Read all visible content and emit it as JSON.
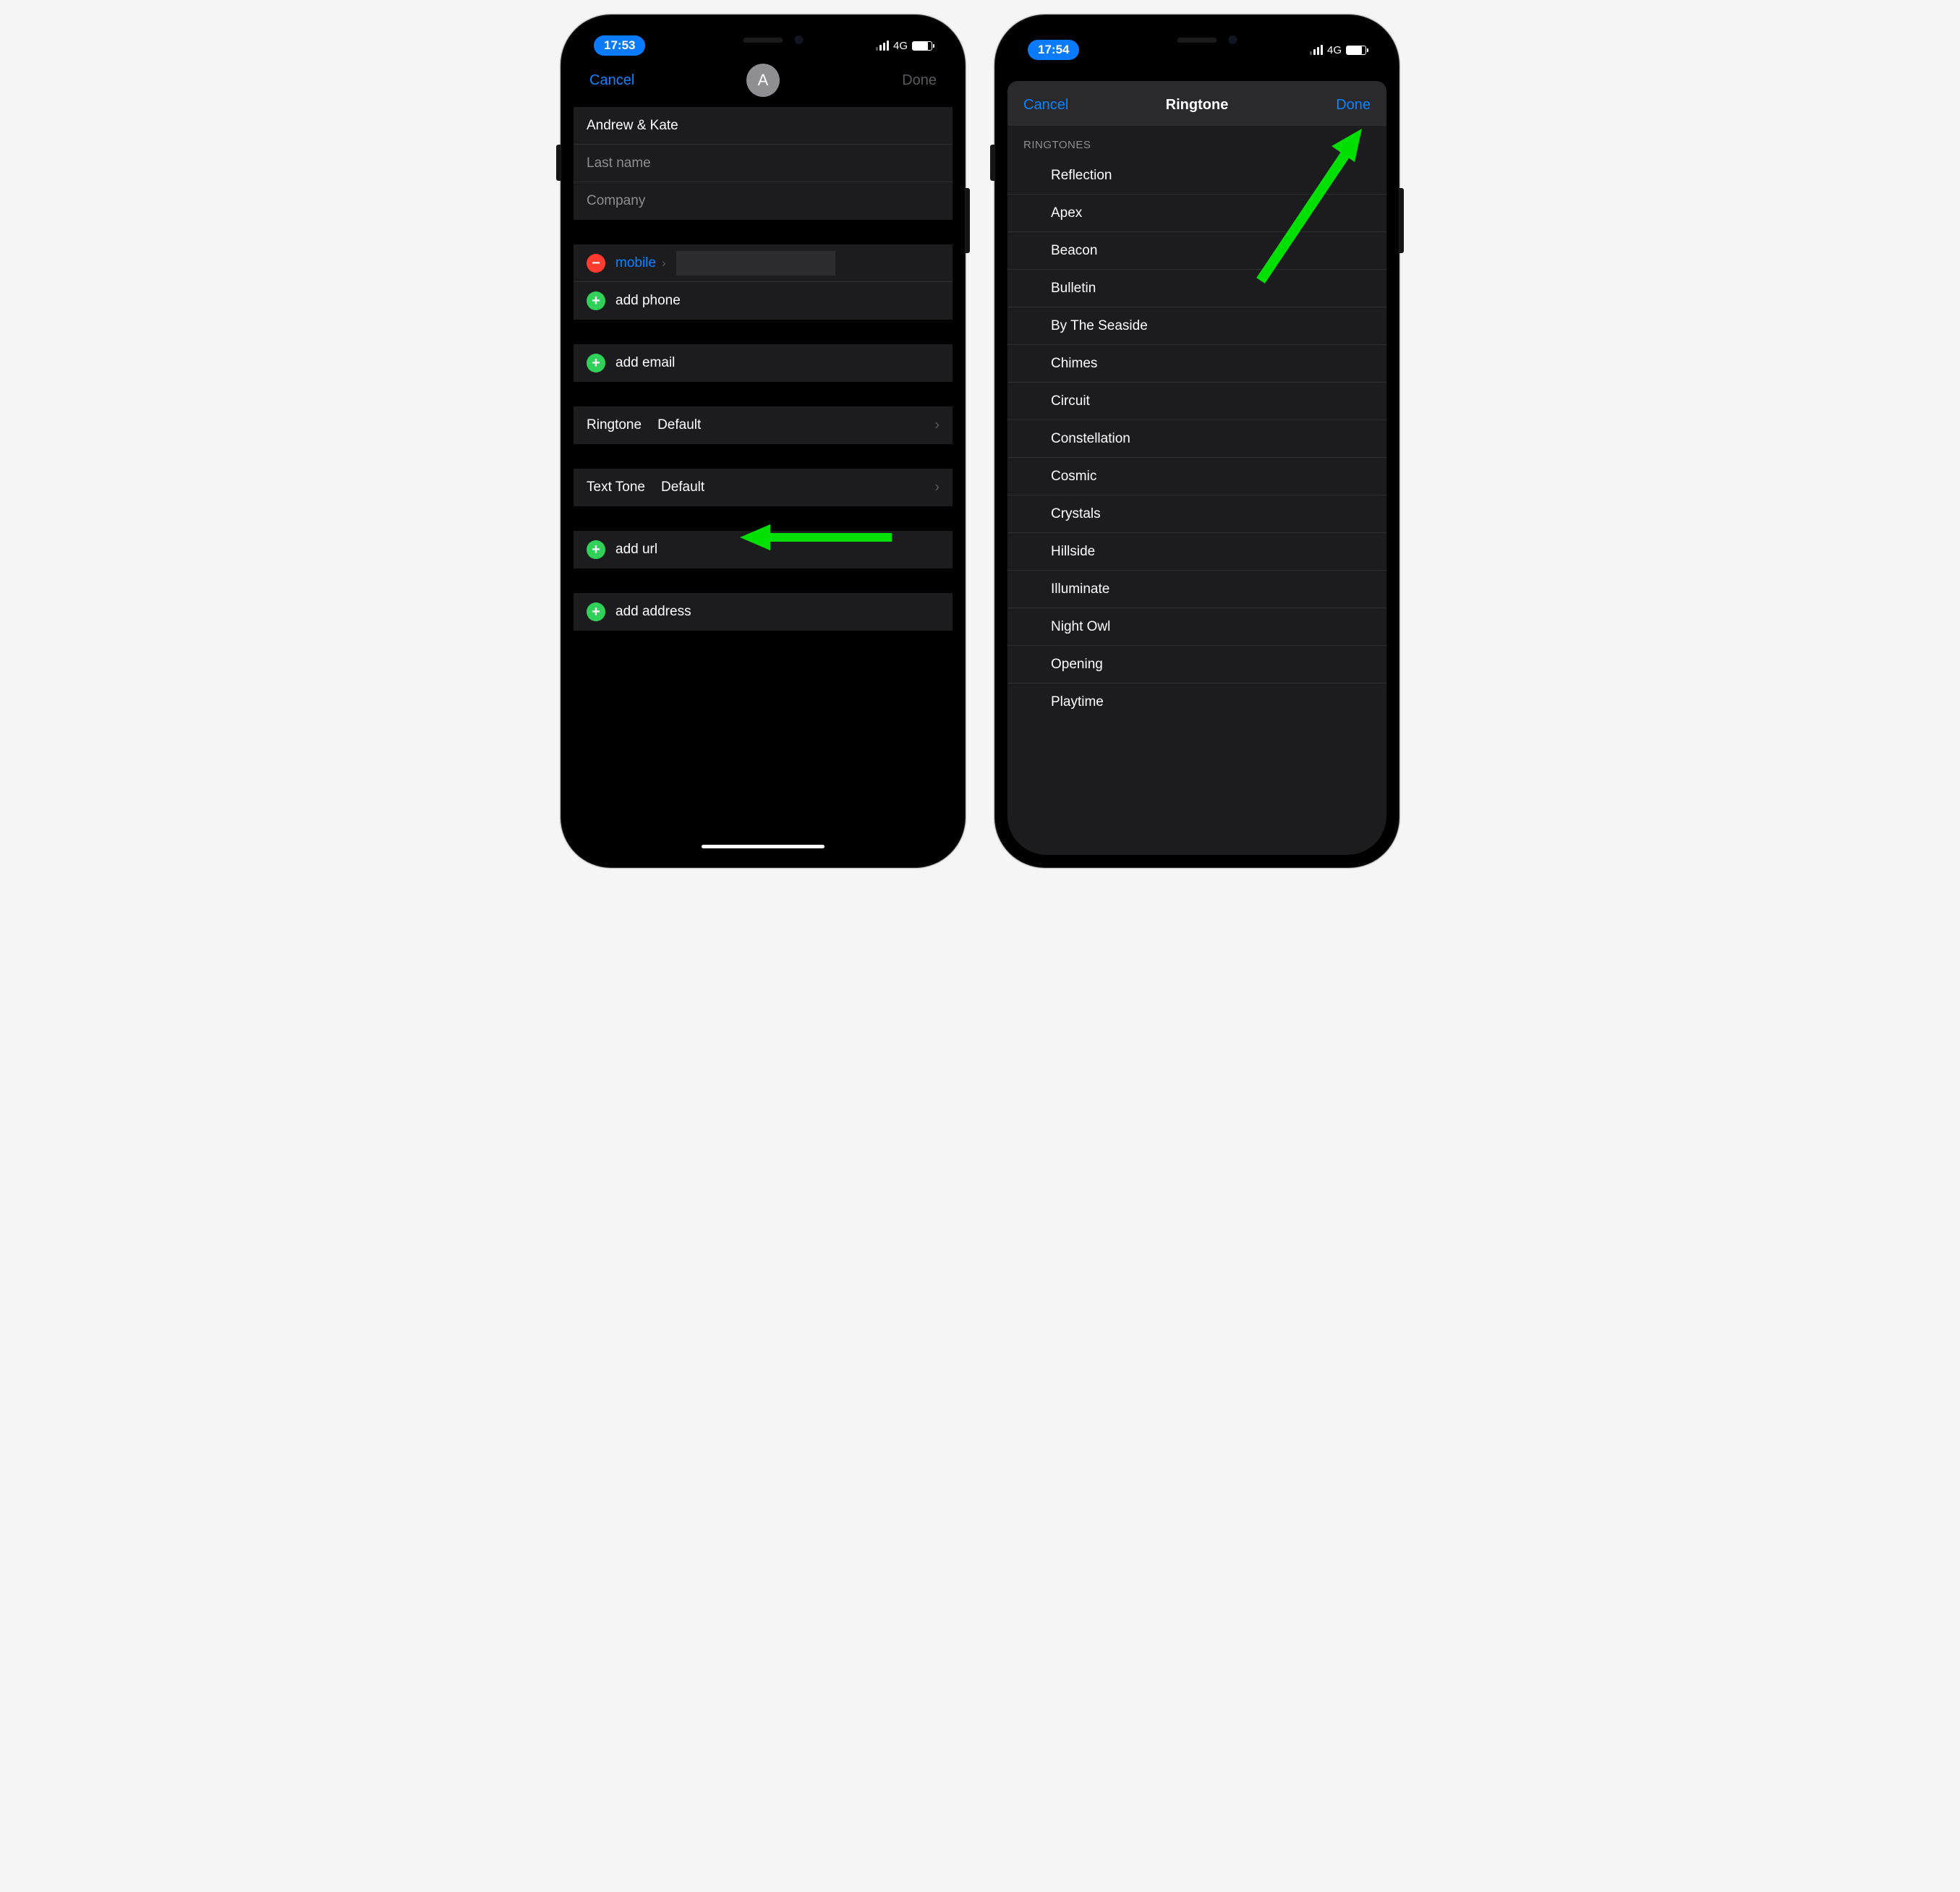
{
  "phone1": {
    "status": {
      "time": "17:53",
      "network": "4G"
    },
    "nav": {
      "cancel": "Cancel",
      "done": "Done",
      "avatar_initial": "A"
    },
    "fields": {
      "first_name_value": "Andrew & Kate",
      "last_name_placeholder": "Last name",
      "company_placeholder": "Company"
    },
    "phone": {
      "type_label": "mobile",
      "add_label": "add phone"
    },
    "email": {
      "add_label": "add email"
    },
    "ringtone": {
      "label": "Ringtone",
      "value": "Default"
    },
    "texttone": {
      "label": "Text Tone",
      "value": "Default"
    },
    "url": {
      "add_label": "add url"
    },
    "address": {
      "add_label": "add address"
    }
  },
  "phone2": {
    "status": {
      "time": "17:54",
      "network": "4G"
    },
    "nav": {
      "cancel": "Cancel",
      "title": "Ringtone",
      "done": "Done"
    },
    "section_header": "RINGTONES",
    "ringtones": [
      "Reflection",
      "Apex",
      "Beacon",
      "Bulletin",
      "By The Seaside",
      "Chimes",
      "Circuit",
      "Constellation",
      "Cosmic",
      "Crystals",
      "Hillside",
      "Illuminate",
      "Night Owl",
      "Opening",
      "Playtime"
    ]
  }
}
